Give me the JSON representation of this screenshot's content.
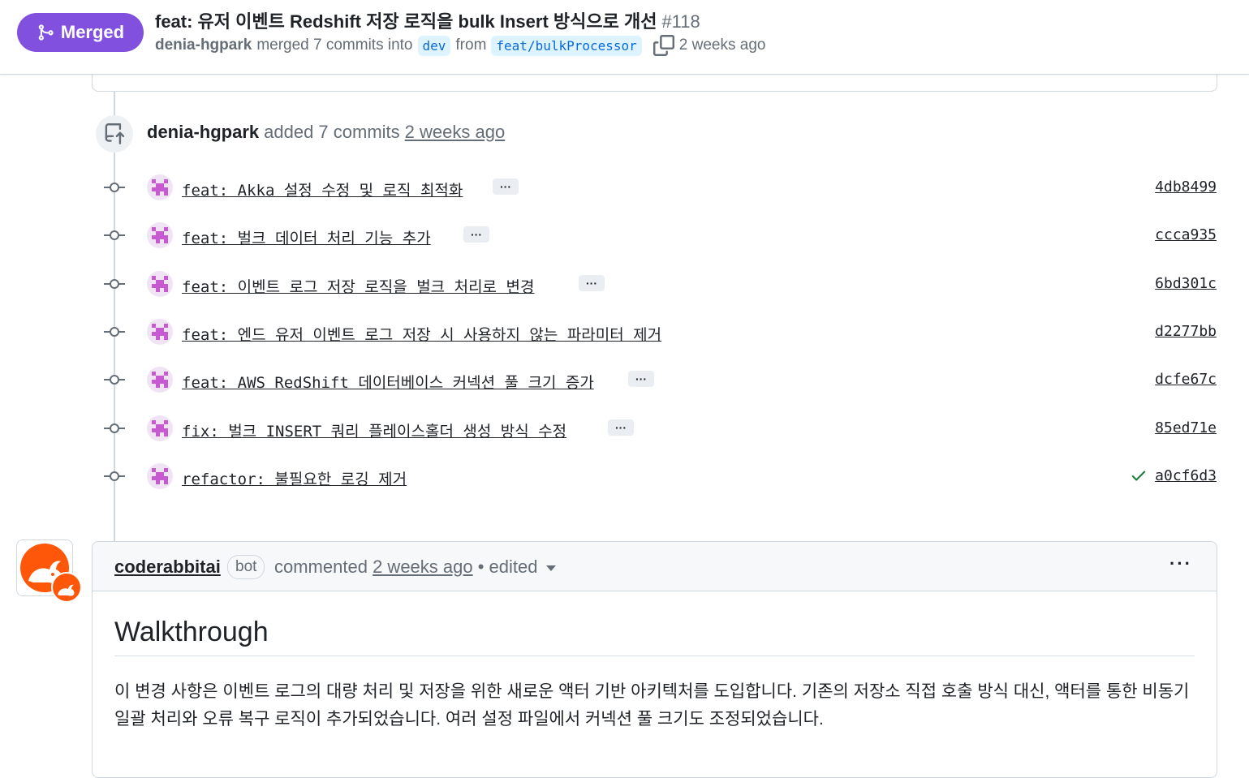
{
  "header": {
    "state": "Merged",
    "title": "feat: 유저 이벤트 Redshift 저장 로직을 bulk Insert 방식으로 개선",
    "number": "#118",
    "author": "denia-hgpark",
    "merged_text": "merged 7 commits into",
    "base_branch": "dev",
    "from_text": "from",
    "head_branch": "feat/bulkProcessor",
    "time": "2 weeks ago"
  },
  "event": {
    "actor": "denia-hgpark",
    "action": "added 7 commits",
    "time": "2 weeks ago",
    "icon": "repo-push-icon"
  },
  "commits": [
    {
      "message": "feat: Akka 설정 수정 및 로직 최적화",
      "has_ellipsis": true,
      "sha": "4db8499"
    },
    {
      "message": "feat: 벌크 데이터 처리 기능 추가",
      "has_ellipsis": true,
      "sha": "ccca935"
    },
    {
      "message": "feat: 이벤트 로그 저장 로직을 벌크 처리로 변경",
      "has_ellipsis": true,
      "sha": "6bd301c"
    },
    {
      "message": "feat: 엔드 유저 이벤트 로그 저장 시 사용하지 않는 파라미터 제거",
      "has_ellipsis": false,
      "sha": "d2277bb"
    },
    {
      "message": "feat: AWS RedShift 데이터베이스 커넥션 풀 크기 증가",
      "has_ellipsis": true,
      "sha": "dcfe67c"
    },
    {
      "message": "fix: 벌크 INSERT 쿼리 플레이스홀더 생성 방식 수정",
      "has_ellipsis": true,
      "sha": "85ed71e"
    },
    {
      "message": "refactor: 불필요한 로깅 제거",
      "has_ellipsis": false,
      "sha": "a0cf6d3",
      "check": true
    }
  ],
  "ellipsis_label": "···",
  "comment": {
    "author": "coderabbitai",
    "badge": "bot",
    "action": "commented",
    "time": "2 weeks ago",
    "edited": "• edited",
    "menu": "···",
    "heading": "Walkthrough",
    "body": "이 변경 사항은 이벤트 로그의 대량 처리 및 저장을 위한 새로운 액터 기반 아키텍처를 도입합니다. 기존의 저장소 직접 호출 방식 대신, 액터를 통한 비동기 일괄 처리와 오류 복구 로직이 추가되었습니다. 여러 설정 파일에서 커넥션 풀 크기도 조정되었습니다."
  },
  "colors": {
    "merged": "#8250df",
    "link": "#0969da",
    "branch_bg": "#ddf4ff",
    "success": "#1a7f37",
    "muted": "#656d76"
  }
}
